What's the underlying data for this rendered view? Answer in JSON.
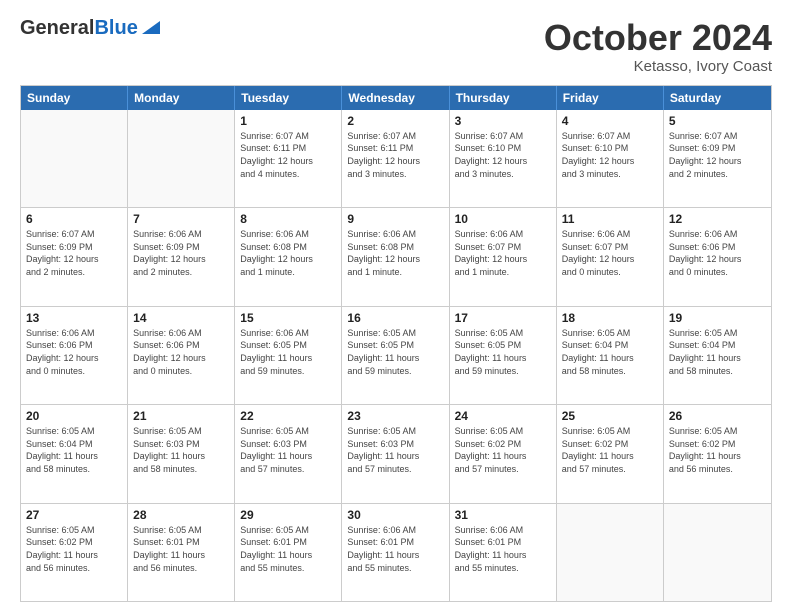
{
  "header": {
    "logo_general": "General",
    "logo_blue": "Blue",
    "month_title": "October 2024",
    "subtitle": "Ketasso, Ivory Coast"
  },
  "weekdays": [
    "Sunday",
    "Monday",
    "Tuesday",
    "Wednesday",
    "Thursday",
    "Friday",
    "Saturday"
  ],
  "rows": [
    [
      {
        "day": "",
        "empty": true,
        "info": ""
      },
      {
        "day": "",
        "empty": true,
        "info": ""
      },
      {
        "day": "1",
        "info": "Sunrise: 6:07 AM\nSunset: 6:11 PM\nDaylight: 12 hours\nand 4 minutes."
      },
      {
        "day": "2",
        "info": "Sunrise: 6:07 AM\nSunset: 6:11 PM\nDaylight: 12 hours\nand 3 minutes."
      },
      {
        "day": "3",
        "info": "Sunrise: 6:07 AM\nSunset: 6:10 PM\nDaylight: 12 hours\nand 3 minutes."
      },
      {
        "day": "4",
        "info": "Sunrise: 6:07 AM\nSunset: 6:10 PM\nDaylight: 12 hours\nand 3 minutes."
      },
      {
        "day": "5",
        "info": "Sunrise: 6:07 AM\nSunset: 6:09 PM\nDaylight: 12 hours\nand 2 minutes."
      }
    ],
    [
      {
        "day": "6",
        "info": "Sunrise: 6:07 AM\nSunset: 6:09 PM\nDaylight: 12 hours\nand 2 minutes."
      },
      {
        "day": "7",
        "info": "Sunrise: 6:06 AM\nSunset: 6:09 PM\nDaylight: 12 hours\nand 2 minutes."
      },
      {
        "day": "8",
        "info": "Sunrise: 6:06 AM\nSunset: 6:08 PM\nDaylight: 12 hours\nand 1 minute."
      },
      {
        "day": "9",
        "info": "Sunrise: 6:06 AM\nSunset: 6:08 PM\nDaylight: 12 hours\nand 1 minute."
      },
      {
        "day": "10",
        "info": "Sunrise: 6:06 AM\nSunset: 6:07 PM\nDaylight: 12 hours\nand 1 minute."
      },
      {
        "day": "11",
        "info": "Sunrise: 6:06 AM\nSunset: 6:07 PM\nDaylight: 12 hours\nand 0 minutes."
      },
      {
        "day": "12",
        "info": "Sunrise: 6:06 AM\nSunset: 6:06 PM\nDaylight: 12 hours\nand 0 minutes."
      }
    ],
    [
      {
        "day": "13",
        "info": "Sunrise: 6:06 AM\nSunset: 6:06 PM\nDaylight: 12 hours\nand 0 minutes."
      },
      {
        "day": "14",
        "info": "Sunrise: 6:06 AM\nSunset: 6:06 PM\nDaylight: 12 hours\nand 0 minutes."
      },
      {
        "day": "15",
        "info": "Sunrise: 6:06 AM\nSunset: 6:05 PM\nDaylight: 11 hours\nand 59 minutes."
      },
      {
        "day": "16",
        "info": "Sunrise: 6:05 AM\nSunset: 6:05 PM\nDaylight: 11 hours\nand 59 minutes."
      },
      {
        "day": "17",
        "info": "Sunrise: 6:05 AM\nSunset: 6:05 PM\nDaylight: 11 hours\nand 59 minutes."
      },
      {
        "day": "18",
        "info": "Sunrise: 6:05 AM\nSunset: 6:04 PM\nDaylight: 11 hours\nand 58 minutes."
      },
      {
        "day": "19",
        "info": "Sunrise: 6:05 AM\nSunset: 6:04 PM\nDaylight: 11 hours\nand 58 minutes."
      }
    ],
    [
      {
        "day": "20",
        "info": "Sunrise: 6:05 AM\nSunset: 6:04 PM\nDaylight: 11 hours\nand 58 minutes."
      },
      {
        "day": "21",
        "info": "Sunrise: 6:05 AM\nSunset: 6:03 PM\nDaylight: 11 hours\nand 58 minutes."
      },
      {
        "day": "22",
        "info": "Sunrise: 6:05 AM\nSunset: 6:03 PM\nDaylight: 11 hours\nand 57 minutes."
      },
      {
        "day": "23",
        "info": "Sunrise: 6:05 AM\nSunset: 6:03 PM\nDaylight: 11 hours\nand 57 minutes."
      },
      {
        "day": "24",
        "info": "Sunrise: 6:05 AM\nSunset: 6:02 PM\nDaylight: 11 hours\nand 57 minutes."
      },
      {
        "day": "25",
        "info": "Sunrise: 6:05 AM\nSunset: 6:02 PM\nDaylight: 11 hours\nand 57 minutes."
      },
      {
        "day": "26",
        "info": "Sunrise: 6:05 AM\nSunset: 6:02 PM\nDaylight: 11 hours\nand 56 minutes."
      }
    ],
    [
      {
        "day": "27",
        "info": "Sunrise: 6:05 AM\nSunset: 6:02 PM\nDaylight: 11 hours\nand 56 minutes."
      },
      {
        "day": "28",
        "info": "Sunrise: 6:05 AM\nSunset: 6:01 PM\nDaylight: 11 hours\nand 56 minutes."
      },
      {
        "day": "29",
        "info": "Sunrise: 6:05 AM\nSunset: 6:01 PM\nDaylight: 11 hours\nand 55 minutes."
      },
      {
        "day": "30",
        "info": "Sunrise: 6:06 AM\nSunset: 6:01 PM\nDaylight: 11 hours\nand 55 minutes."
      },
      {
        "day": "31",
        "info": "Sunrise: 6:06 AM\nSunset: 6:01 PM\nDaylight: 11 hours\nand 55 minutes."
      },
      {
        "day": "",
        "empty": true,
        "info": ""
      },
      {
        "day": "",
        "empty": true,
        "info": ""
      }
    ]
  ]
}
